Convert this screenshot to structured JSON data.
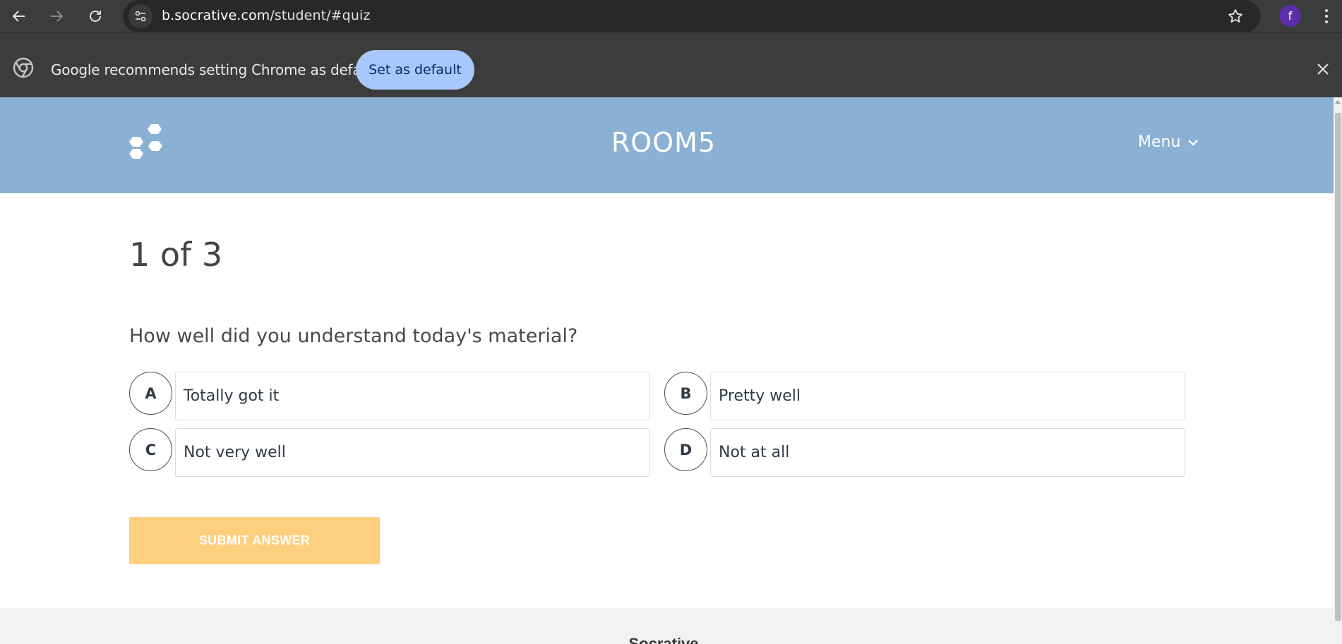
{
  "browser": {
    "url_host": "b.socrative.com",
    "url_path": "/student/#quiz",
    "profile_initial": "f",
    "infobar_text": "Google recommends setting Chrome as default",
    "infobar_button": "Set as default",
    "icons": [
      "back-icon",
      "forward-icon",
      "reload-icon",
      "site-info-icon",
      "bookmark-star-icon",
      "kebab-menu-icon",
      "chrome-logo-icon",
      "close-icon"
    ]
  },
  "header": {
    "room": "ROOM5",
    "menu_label": "Menu",
    "colors": {
      "header_bg": "#8ab1d4",
      "text": "#ffffff"
    }
  },
  "quiz": {
    "counter": "1 of 3",
    "question": "How well did you understand today's material?",
    "options": [
      {
        "letter": "A",
        "text": "Totally got it"
      },
      {
        "letter": "B",
        "text": "Pretty well"
      },
      {
        "letter": "C",
        "text": "Not very well"
      },
      {
        "letter": "D",
        "text": "Not at all"
      }
    ],
    "submit_label": "SUBMIT ANSWER",
    "colors": {
      "submit_bg": "#fecf7e"
    }
  },
  "footer": {
    "brand": "Socrative"
  }
}
